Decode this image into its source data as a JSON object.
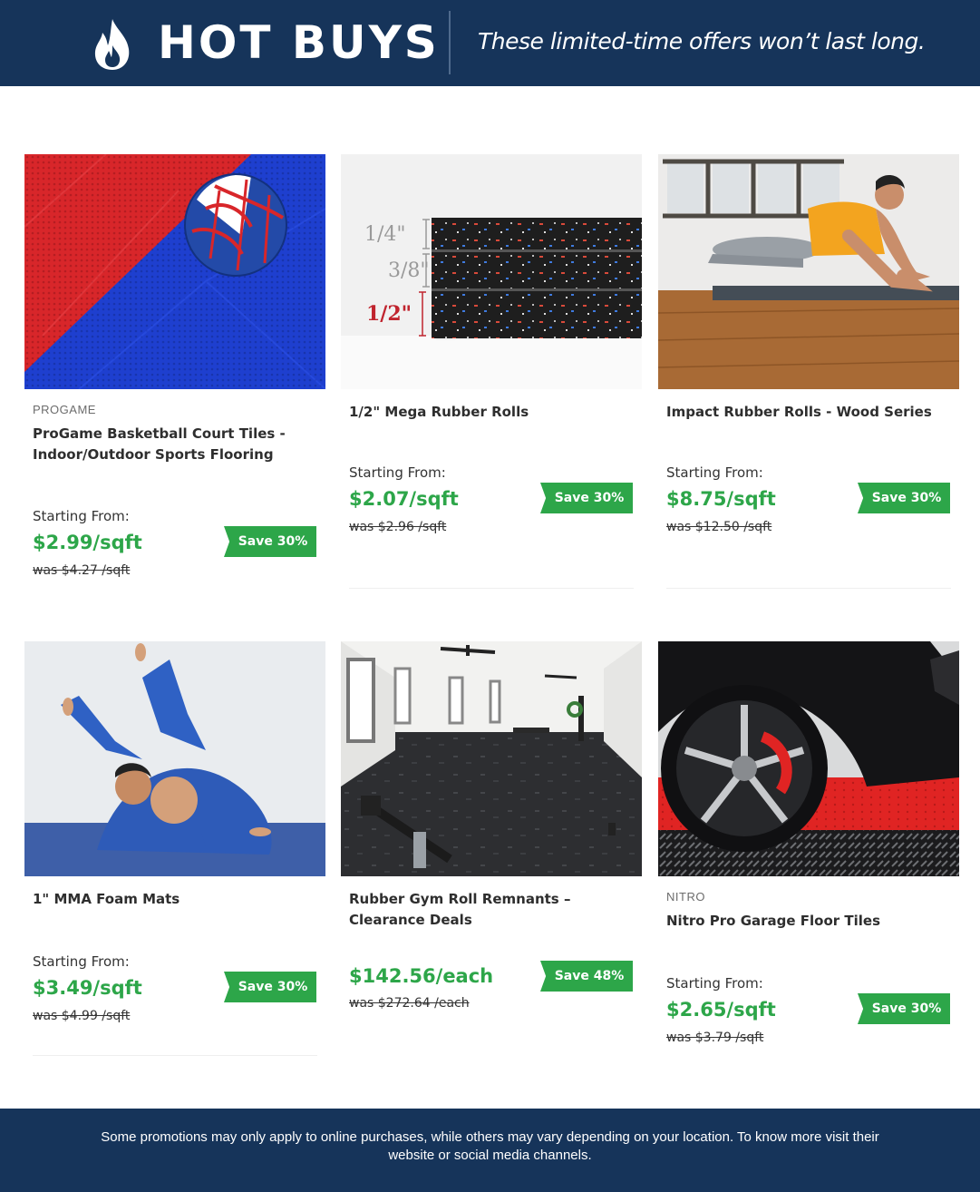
{
  "header": {
    "title": "HOT BUYS",
    "tagline": "These limited-time offers won’t last long.",
    "icon": "flame-icon"
  },
  "products": [
    {
      "brand": "PROGAME",
      "name": "ProGame Basketball Court Tiles - Indoor/Outdoor Sports Flooring",
      "starting_label": "Starting From:",
      "price": "$2.99/sqft",
      "was": "was $4.27 /sqft",
      "save": "Save 30%"
    },
    {
      "brand": "",
      "name": "1/2\" Mega Rubber Rolls",
      "starting_label": "Starting From:",
      "price": "$2.07/sqft",
      "was": "was $2.96 /sqft",
      "save": "Save 30%",
      "image_labels": [
        "1/4\"",
        "3/8\"",
        "1/2\""
      ]
    },
    {
      "brand": "",
      "name": "Impact Rubber Rolls - Wood Series",
      "starting_label": "Starting From:",
      "price": "$8.75/sqft",
      "was": "was $12.50 /sqft",
      "save": "Save 30%"
    },
    {
      "brand": "",
      "name": "1\" MMA Foam Mats",
      "starting_label": "Starting From:",
      "price": "$3.49/sqft",
      "was": "was $4.99 /sqft",
      "save": "Save 30%"
    },
    {
      "brand": "",
      "name": "Rubber Gym Roll Remnants – Clearance Deals",
      "starting_label": "",
      "price": "$142.56/each",
      "was": "was $272.64 /each",
      "save": "Save 48%"
    },
    {
      "brand": "NITRO",
      "name": "Nitro Pro Garage Floor Tiles",
      "starting_label": "Starting From:",
      "price": "$2.65/sqft",
      "was": "was $3.79 /sqft",
      "save": "Save 30%"
    }
  ],
  "footer": {
    "note": "Some promotions may only apply to online purchases, while others may vary depending on your location. To know more visit their website or social media channels."
  },
  "colors": {
    "navy": "#16345a",
    "accent_green": "#2da649"
  }
}
